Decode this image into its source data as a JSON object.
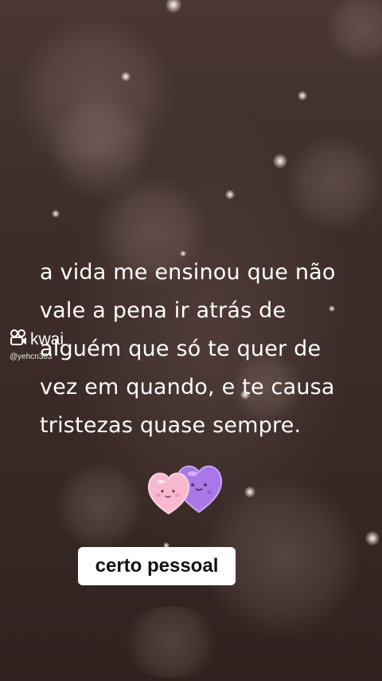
{
  "quote": {
    "lines": [
      "a vida me ensinou que não",
      "vale a pena ir atrás de",
      "alguém que só te quer de",
      "vez em quando, e te causa",
      "tristezas quase sempre."
    ]
  },
  "watermark": {
    "brand": "kwai",
    "handle": "@yehcn303",
    "icon": "kwai-camera-icon"
  },
  "sticker": {
    "icon": "hearts-sticker-icon",
    "colors": {
      "pink_heart": "#f7b9cf",
      "purple_heart": "#a978e6"
    }
  },
  "caption": {
    "text": "certo pessoal"
  },
  "colors": {
    "background": "#3b2a27",
    "text": "#ffffff",
    "caption_bg": "#ffffff",
    "caption_text": "#111111"
  }
}
